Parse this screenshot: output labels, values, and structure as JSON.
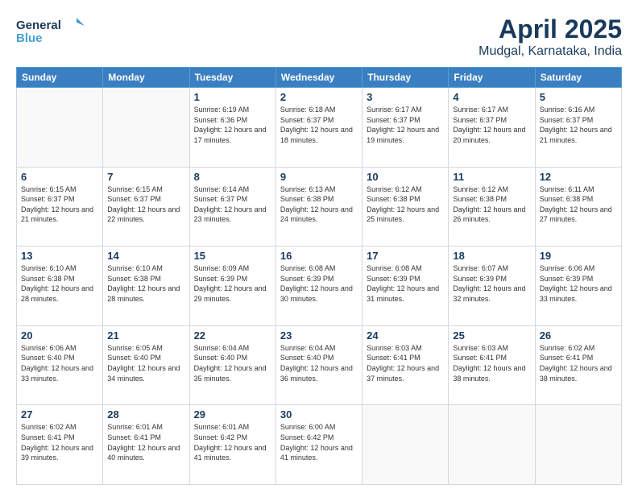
{
  "header": {
    "logo_line1": "General",
    "logo_line2": "Blue",
    "title": "April 2025",
    "subtitle": "Mudgal, Karnataka, India"
  },
  "days_of_week": [
    "Sunday",
    "Monday",
    "Tuesday",
    "Wednesday",
    "Thursday",
    "Friday",
    "Saturday"
  ],
  "weeks": [
    [
      {
        "day": "",
        "info": ""
      },
      {
        "day": "",
        "info": ""
      },
      {
        "day": "1",
        "info": "Sunrise: 6:19 AM\nSunset: 6:36 PM\nDaylight: 12 hours and 17 minutes."
      },
      {
        "day": "2",
        "info": "Sunrise: 6:18 AM\nSunset: 6:37 PM\nDaylight: 12 hours and 18 minutes."
      },
      {
        "day": "3",
        "info": "Sunrise: 6:17 AM\nSunset: 6:37 PM\nDaylight: 12 hours and 19 minutes."
      },
      {
        "day": "4",
        "info": "Sunrise: 6:17 AM\nSunset: 6:37 PM\nDaylight: 12 hours and 20 minutes."
      },
      {
        "day": "5",
        "info": "Sunrise: 6:16 AM\nSunset: 6:37 PM\nDaylight: 12 hours and 21 minutes."
      }
    ],
    [
      {
        "day": "6",
        "info": "Sunrise: 6:15 AM\nSunset: 6:37 PM\nDaylight: 12 hours and 21 minutes."
      },
      {
        "day": "7",
        "info": "Sunrise: 6:15 AM\nSunset: 6:37 PM\nDaylight: 12 hours and 22 minutes."
      },
      {
        "day": "8",
        "info": "Sunrise: 6:14 AM\nSunset: 6:37 PM\nDaylight: 12 hours and 23 minutes."
      },
      {
        "day": "9",
        "info": "Sunrise: 6:13 AM\nSunset: 6:38 PM\nDaylight: 12 hours and 24 minutes."
      },
      {
        "day": "10",
        "info": "Sunrise: 6:12 AM\nSunset: 6:38 PM\nDaylight: 12 hours and 25 minutes."
      },
      {
        "day": "11",
        "info": "Sunrise: 6:12 AM\nSunset: 6:38 PM\nDaylight: 12 hours and 26 minutes."
      },
      {
        "day": "12",
        "info": "Sunrise: 6:11 AM\nSunset: 6:38 PM\nDaylight: 12 hours and 27 minutes."
      }
    ],
    [
      {
        "day": "13",
        "info": "Sunrise: 6:10 AM\nSunset: 6:38 PM\nDaylight: 12 hours and 28 minutes."
      },
      {
        "day": "14",
        "info": "Sunrise: 6:10 AM\nSunset: 6:38 PM\nDaylight: 12 hours and 28 minutes."
      },
      {
        "day": "15",
        "info": "Sunrise: 6:09 AM\nSunset: 6:39 PM\nDaylight: 12 hours and 29 minutes."
      },
      {
        "day": "16",
        "info": "Sunrise: 6:08 AM\nSunset: 6:39 PM\nDaylight: 12 hours and 30 minutes."
      },
      {
        "day": "17",
        "info": "Sunrise: 6:08 AM\nSunset: 6:39 PM\nDaylight: 12 hours and 31 minutes."
      },
      {
        "day": "18",
        "info": "Sunrise: 6:07 AM\nSunset: 6:39 PM\nDaylight: 12 hours and 32 minutes."
      },
      {
        "day": "19",
        "info": "Sunrise: 6:06 AM\nSunset: 6:39 PM\nDaylight: 12 hours and 33 minutes."
      }
    ],
    [
      {
        "day": "20",
        "info": "Sunrise: 6:06 AM\nSunset: 6:40 PM\nDaylight: 12 hours and 33 minutes."
      },
      {
        "day": "21",
        "info": "Sunrise: 6:05 AM\nSunset: 6:40 PM\nDaylight: 12 hours and 34 minutes."
      },
      {
        "day": "22",
        "info": "Sunrise: 6:04 AM\nSunset: 6:40 PM\nDaylight: 12 hours and 35 minutes."
      },
      {
        "day": "23",
        "info": "Sunrise: 6:04 AM\nSunset: 6:40 PM\nDaylight: 12 hours and 36 minutes."
      },
      {
        "day": "24",
        "info": "Sunrise: 6:03 AM\nSunset: 6:41 PM\nDaylight: 12 hours and 37 minutes."
      },
      {
        "day": "25",
        "info": "Sunrise: 6:03 AM\nSunset: 6:41 PM\nDaylight: 12 hours and 38 minutes."
      },
      {
        "day": "26",
        "info": "Sunrise: 6:02 AM\nSunset: 6:41 PM\nDaylight: 12 hours and 38 minutes."
      }
    ],
    [
      {
        "day": "27",
        "info": "Sunrise: 6:02 AM\nSunset: 6:41 PM\nDaylight: 12 hours and 39 minutes."
      },
      {
        "day": "28",
        "info": "Sunrise: 6:01 AM\nSunset: 6:41 PM\nDaylight: 12 hours and 40 minutes."
      },
      {
        "day": "29",
        "info": "Sunrise: 6:01 AM\nSunset: 6:42 PM\nDaylight: 12 hours and 41 minutes."
      },
      {
        "day": "30",
        "info": "Sunrise: 6:00 AM\nSunset: 6:42 PM\nDaylight: 12 hours and 41 minutes."
      },
      {
        "day": "",
        "info": ""
      },
      {
        "day": "",
        "info": ""
      },
      {
        "day": "",
        "info": ""
      }
    ]
  ]
}
